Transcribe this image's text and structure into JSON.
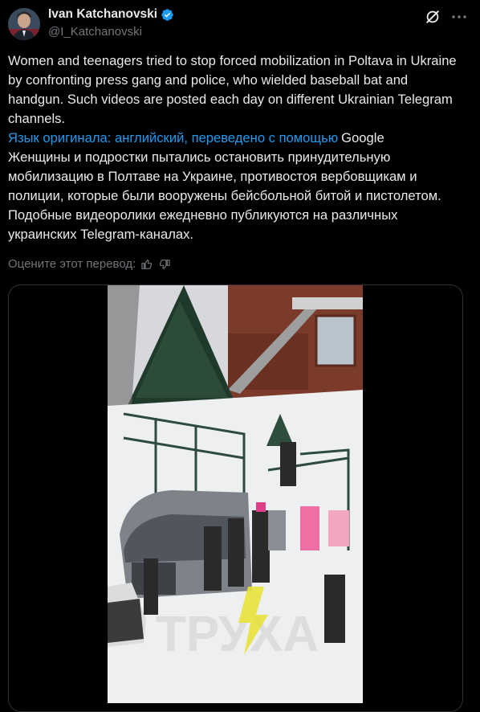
{
  "author": {
    "name": "Ivan Katchanovski",
    "handle": "@I_Katchanovski"
  },
  "tweet": {
    "original_text": "Women and teenagers tried to stop forced mobilization in Poltava in Ukraine by confronting press gang and police, who wielded baseball bat and handgun. Such videos are posted each day on different Ukrainian Telegram channels.",
    "translation_label": "Язык оригинала: английский, переведено с помощью",
    "translation_provider": "Google",
    "translated_text": "Женщины и подростки пытались остановить принудительную мобилизацию в Полтаве на Украине, противостоя вербовщикам и полиции, которые были вооружены бейсбольной битой и пистолетом. Подобные видеоролики ежедневно публикуются на различных украинских Telegram-каналах.",
    "rate_prompt": "Оцените этот перевод:"
  },
  "media": {
    "watermark": "ТРУХА"
  },
  "colors": {
    "background": "#000000",
    "text": "#e7e9ea",
    "muted": "#71767b",
    "accent": "#1d9bf0",
    "watermark": "#e8e23a"
  },
  "icons": [
    "verified-badge-icon",
    "grok-icon",
    "more-options-icon",
    "thumbs-up-icon",
    "thumbs-down-icon"
  ]
}
